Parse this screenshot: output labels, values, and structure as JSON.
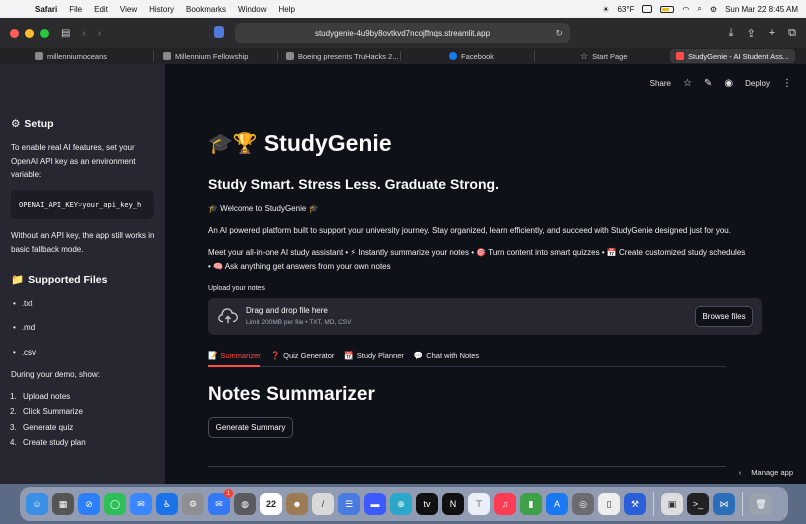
{
  "menubar": {
    "app_name": "Safari",
    "items": [
      "File",
      "Edit",
      "View",
      "History",
      "Bookmarks",
      "Window",
      "Help"
    ],
    "temperature": "63°F",
    "datetime": "Sun Mar 22  8:45 AM"
  },
  "browser": {
    "url": "studygenie-4u9by8ovtkvd7ncojffnqs.streamlit.app",
    "tabs": [
      {
        "label": "millenniumoceans",
        "icon": "page-icon"
      },
      {
        "label": "Millennium Fellowship",
        "icon": "site-icon"
      },
      {
        "label": "Boeing presents TruHacks 2...",
        "icon": "d-icon"
      },
      {
        "label": "Facebook",
        "icon": "facebook-icon"
      },
      {
        "label": "Start Page",
        "icon": "star-icon"
      },
      {
        "label": "StudyGenie - AI Student Ass...",
        "icon": "streamlit-icon",
        "active": true
      }
    ]
  },
  "sidebar": {
    "setup_heading": "Setup",
    "setup_text": "To enable real AI features, set your OpenAI API key as an environment variable:",
    "code_key": "OPENAI_API_KEY",
    "code_eq": "=",
    "code_val": "your_api_key_h",
    "fallback_text": "Without an API key, the app still works in basic fallback mode.",
    "files_heading": "Supported Files",
    "files": [
      ".txt",
      ".md",
      ".csv"
    ],
    "demo_heading": "During your demo, show:",
    "demo_steps": [
      "Upload notes",
      "Click Summarize",
      "Generate quiz",
      "Create study plan"
    ]
  },
  "topbar": {
    "share": "Share",
    "deploy": "Deploy"
  },
  "main": {
    "title": "StudyGenie",
    "title_emojis": "🎓🏆",
    "subtitle": "Study Smart. Stress Less. Graduate Strong.",
    "welcome": "🎓 Welcome to StudyGenie 🎓",
    "intro": "An AI powered platform built to support your university journey. Stay organized, learn efficiently, and succeed with StudyGenie designed just for you.",
    "features": "Meet your all-in-one AI study assistant • ⚡ Instantly summarize your notes • 🎯 Turn content into smart quizzes • 📅 Create customized study schedules • 🧠 Ask anything get answers from your own notes",
    "upload_label": "Upload your notes",
    "drop_title": "Drag and drop file here",
    "drop_sub": "Limit 200MB per file • TXT, MD, CSV",
    "browse": "Browse files",
    "tabs": [
      {
        "icon": "📝",
        "label": "Summarizer"
      },
      {
        "icon": "❓",
        "label": "Quiz Generator"
      },
      {
        "icon": "📆",
        "label": "Study Planner"
      },
      {
        "icon": "💬",
        "label": "Chat with Notes"
      }
    ],
    "section_title": "Notes Summarizer",
    "generate": "Generate Summary",
    "manage_app": "Manage app"
  },
  "colors": {
    "app_bg": "#0e1117",
    "sidebar_bg": "#262730",
    "accent": "#ff4b4b"
  },
  "dock": {
    "calendar_date": "22",
    "mail_badge": "1"
  }
}
